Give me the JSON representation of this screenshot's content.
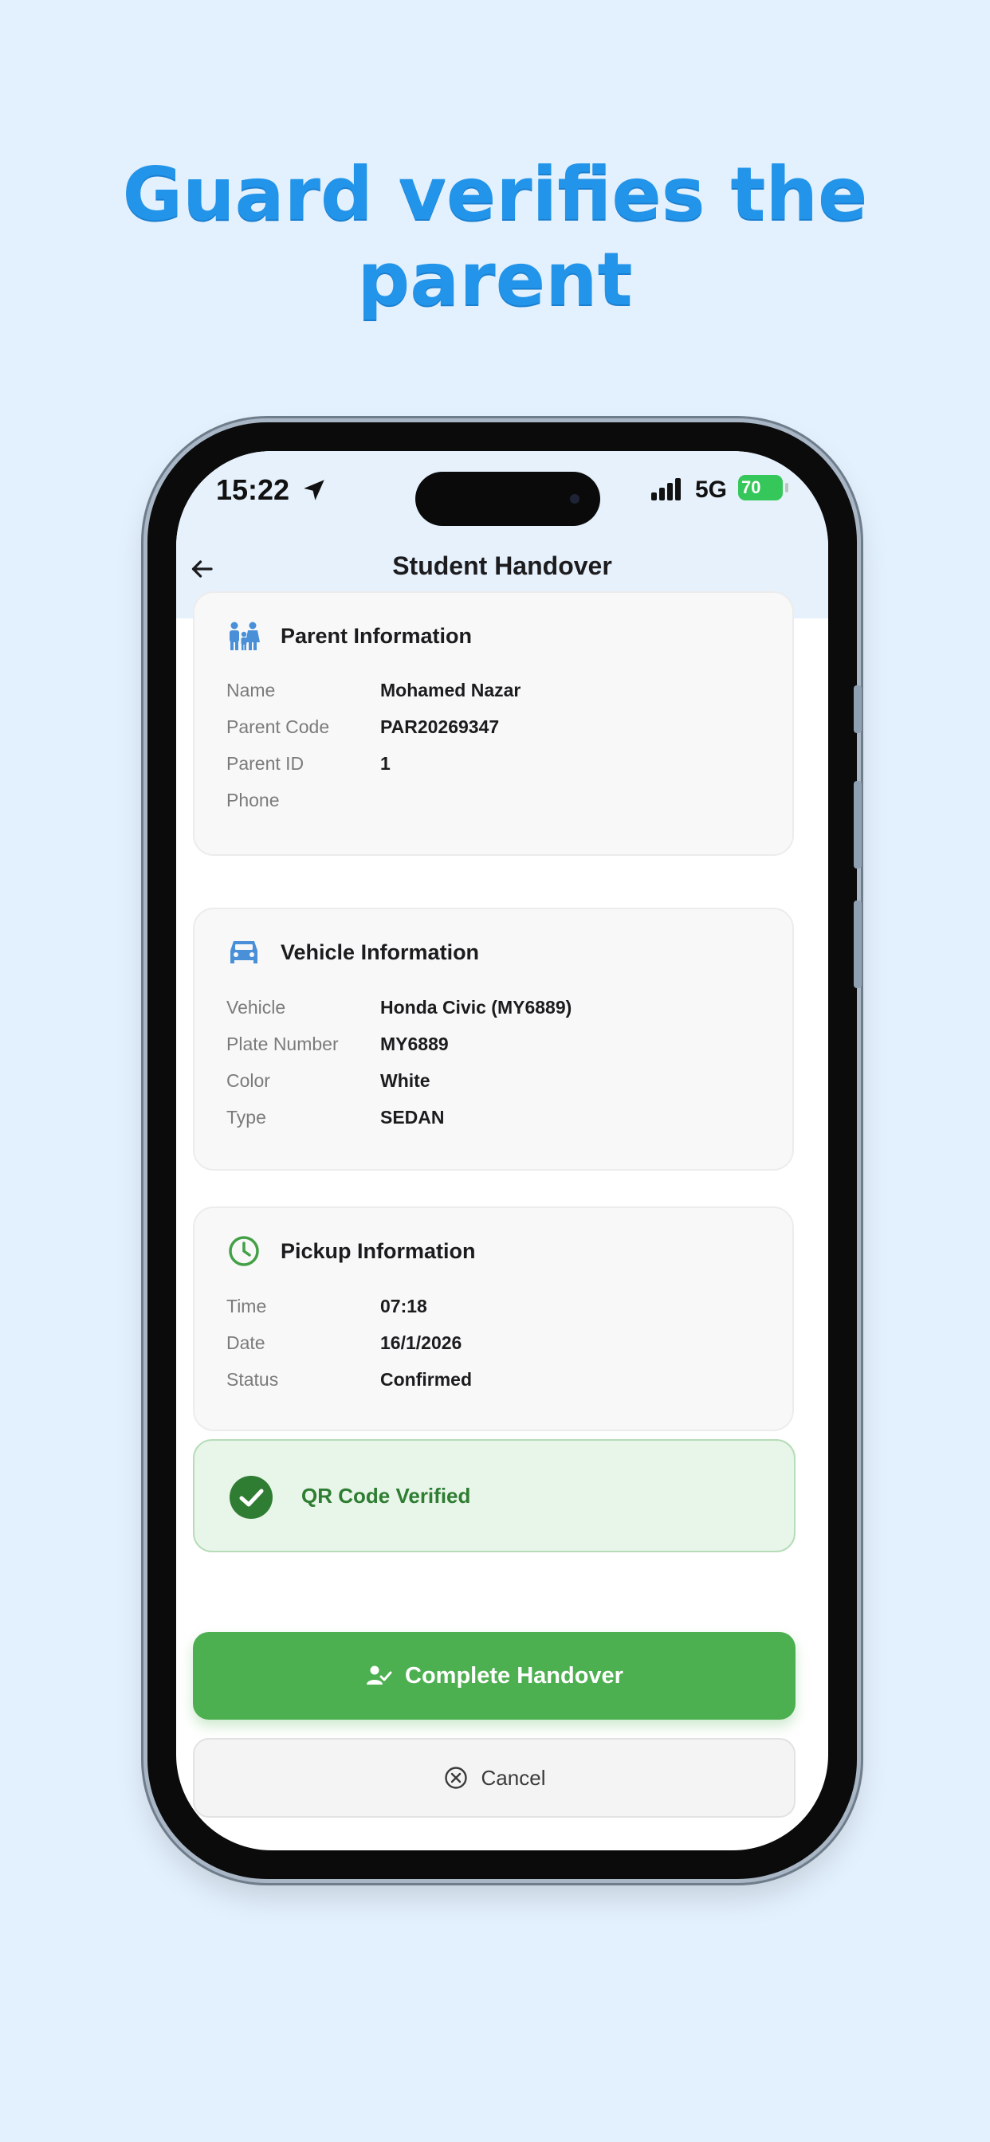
{
  "headline": "Guard verifies the parent",
  "status_bar": {
    "time": "15:22",
    "network": "5G",
    "battery": "70"
  },
  "header": {
    "title": "Student Handover"
  },
  "parent_card": {
    "title": "Parent Information",
    "icon": "family-icon",
    "rows": [
      {
        "label": "Name",
        "value": "Mohamed Nazar"
      },
      {
        "label": "Parent Code",
        "value": "PAR20269347"
      },
      {
        "label": "Parent ID",
        "value": "1"
      },
      {
        "label": "Phone",
        "value": ""
      }
    ]
  },
  "vehicle_card": {
    "title": "Vehicle Information",
    "icon": "car-icon",
    "rows": [
      {
        "label": "Vehicle",
        "value": "Honda Civic (MY6889)"
      },
      {
        "label": "Plate Number",
        "value": "MY6889"
      },
      {
        "label": "Color",
        "value": "White"
      },
      {
        "label": "Type",
        "value": "SEDAN"
      }
    ]
  },
  "pickup_card": {
    "title": "Pickup Information",
    "icon": "clock-icon",
    "rows": [
      {
        "label": "Time",
        "value": "07:18"
      },
      {
        "label": "Date",
        "value": "16/1/2026"
      },
      {
        "label": "Status",
        "value": "Confirmed"
      }
    ]
  },
  "verified": {
    "text": "QR Code Verified"
  },
  "actions": {
    "complete_label": "Complete Handover",
    "cancel_label": "Cancel"
  },
  "colors": {
    "background": "#e3f0fd",
    "headline": "#2295ea",
    "primary_green": "#4caf50",
    "verified_green": "#2e7d32",
    "accent_blue": "#4a90d9"
  }
}
